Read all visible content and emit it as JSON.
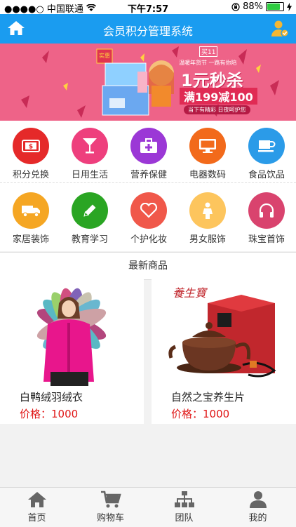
{
  "status": {
    "carrier": "●●●●○ 中国联通",
    "time": "下午7:57",
    "battery": "88%",
    "battery_level": 0.88
  },
  "header": {
    "title": "会员积分管理系统"
  },
  "banner": {
    "badge": "实惠",
    "promo_big": "1元秒杀",
    "promo_sub": "满199减100",
    "tagline": "当下有精彩 日夜呵护您",
    "top_text": "温暖年货节 一路有你陪",
    "tiny_tag": "买11"
  },
  "categories": [
    {
      "label": "积分兑换",
      "color": "#e52929",
      "icon": "money-icon"
    },
    {
      "label": "日用生活",
      "color": "#ee3f7d",
      "icon": "cocktail-icon"
    },
    {
      "label": "营养保健",
      "color": "#9b38d6",
      "icon": "medkit-icon"
    },
    {
      "label": "电器数码",
      "color": "#f26a1b",
      "icon": "monitor-icon"
    },
    {
      "label": "食品饮品",
      "color": "#2b9be8",
      "icon": "cup-icon"
    },
    {
      "label": "家居装饰",
      "color": "#f5a623",
      "icon": "truck-icon"
    },
    {
      "label": "教育学习",
      "color": "#2aa523",
      "icon": "pencil-icon"
    },
    {
      "label": "个护化妆",
      "color": "#f0584a",
      "icon": "heart-icon"
    },
    {
      "label": "男女服饰",
      "color": "#fdc55d",
      "icon": "person-icon"
    },
    {
      "label": "珠宝首饰",
      "color": "#d9436e",
      "icon": "headphones-icon"
    }
  ],
  "section": {
    "title": "最新商品"
  },
  "products": [
    {
      "name": "白鸭绒羽绒衣",
      "price": "价格：1000"
    },
    {
      "name": "自然之宝养生片",
      "price": "价格：1000",
      "brand_mark": "養生寶"
    }
  ],
  "tabs": [
    {
      "label": "首页",
      "icon": "home-icon"
    },
    {
      "label": "购物车",
      "icon": "cart-icon"
    },
    {
      "label": "团队",
      "icon": "team-icon"
    },
    {
      "label": "我的",
      "icon": "user-icon"
    }
  ]
}
